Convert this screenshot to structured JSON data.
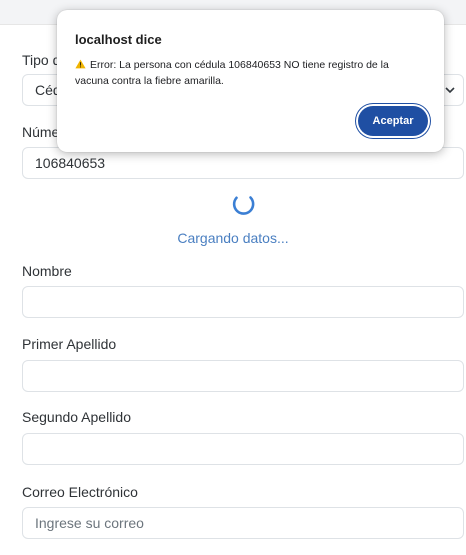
{
  "dialog": {
    "title": "localhost dice",
    "message": "Error: La persona con cédula 106840653 NO tiene registro de la vacuna contra la fiebre amarilla.",
    "accept_label": "Aceptar"
  },
  "form": {
    "doc_type_label": "Tipo d",
    "doc_type_value": "Céd",
    "number_label": "Núme",
    "number_value": "106840653",
    "loading_text": "Cargando datos...",
    "name_label": "Nombre",
    "first_surname_label": "Primer Apellido",
    "second_surname_label": "Segundo Apellido",
    "email_label": "Correo Electrónico",
    "email_placeholder": "Ingrese su correo"
  },
  "colors": {
    "accent": "#1f4fa3",
    "loading": "#4a7fc1",
    "warning": "#f0b400"
  },
  "icons": {
    "warning": "warning-icon",
    "spinner": "loading-spinner-icon",
    "chevron": "chevron-down-icon"
  }
}
